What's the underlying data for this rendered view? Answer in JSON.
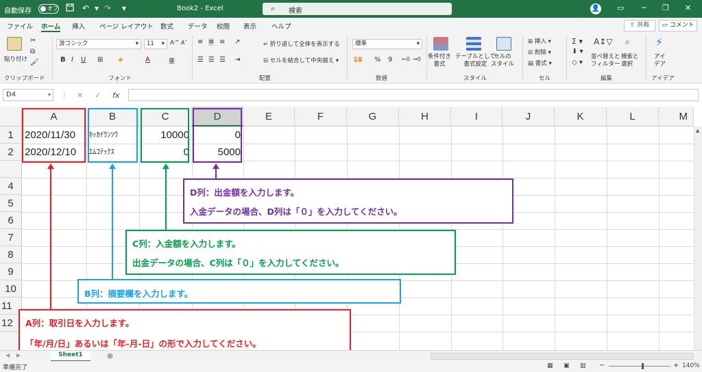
{
  "titlebar": {
    "autosave_label": "自動保存",
    "autosave_state": "オフ",
    "doc_title": "Book2  -  Excel",
    "search_placeholder": "検索",
    "icons": [
      "save-icon",
      "undo-icon",
      "redo-icon",
      "customize-qat-icon",
      "user-avatar",
      "ribbon-display-icon",
      "minimize-icon",
      "restore-icon",
      "close-icon"
    ]
  },
  "ribbon_tabs": [
    "ファイル",
    "ホーム",
    "挿入",
    "ページ レイアウト",
    "数式",
    "データ",
    "校閲",
    "表示",
    "ヘルプ"
  ],
  "active_tab": "ホーム",
  "share_label": "共有",
  "comment_label": "コメント",
  "ribbon": {
    "clipboard": {
      "paste": "貼り付け",
      "label": "クリップボード"
    },
    "font": {
      "name": "游ゴシック",
      "size": "11",
      "label": "フォント"
    },
    "alignment": {
      "wrap": "折り返して全体を表示する",
      "merge": "セルを結合して中央揃え",
      "label": "配置"
    },
    "number": {
      "format": "標準",
      "label": "数値"
    },
    "styles": {
      "conditional": "条件付き\n書式",
      "as_table": "テーブルとして\n書式設定",
      "cell_styles": "セルの\nスタイル",
      "label": "スタイル"
    },
    "cells": {
      "insert": "挿入",
      "delete": "削除",
      "format": "書式",
      "label": "セル"
    },
    "editing": {
      "sort_filter": "並べ替えと\nフィルター",
      "find_select": "検索と\n選択",
      "label": "編集"
    },
    "ideas": {
      "button": "アイ\nデア",
      "label": "アイデア"
    }
  },
  "formula_bar": {
    "name_box": "D4",
    "fx_label": "fx",
    "cancel": "✕",
    "enter": "✓",
    "content": ""
  },
  "grid": {
    "columns": [
      "A",
      "B",
      "C",
      "D",
      "E",
      "F",
      "G",
      "H",
      "I",
      "J",
      "K",
      "L",
      "M"
    ],
    "selected_column": "D",
    "rows": [
      "1",
      "2",
      "4",
      "5",
      "6",
      "7",
      "8",
      "9",
      "10",
      "11",
      "12"
    ],
    "cells": {
      "A1": "2020/11/30",
      "B1": "ﾎｯｶｲｳﾝｿｳ",
      "C1": "10000",
      "D1": "0",
      "A2": "2020/12/10",
      "B2": "ｴﾑｺﾃｯｸｽ",
      "C2": "0",
      "D2": "5000"
    }
  },
  "callouts": {
    "D": {
      "line1": "D列：出金額を入力します。",
      "line2": "入金データの場合、D列は「０」を入力してください。",
      "color": "#7030a0"
    },
    "C": {
      "line1": "C列：入金額を入力します。",
      "line2": "出金データの場合、C列は「０」を入力してください。",
      "color": "#00a14b"
    },
    "B": {
      "line1": "B列：摘要欄を入力します。",
      "color": "#1ba1e2"
    },
    "A": {
      "line1": "A列：取引日を入力します。",
      "line2": "「年/月/日」あるいは「年-月-日」の形で入力してください。",
      "color": "#ee1c25"
    }
  },
  "sheet_tab": "Sheet1",
  "status": {
    "ready": "準備完了",
    "zoom": "140%"
  }
}
